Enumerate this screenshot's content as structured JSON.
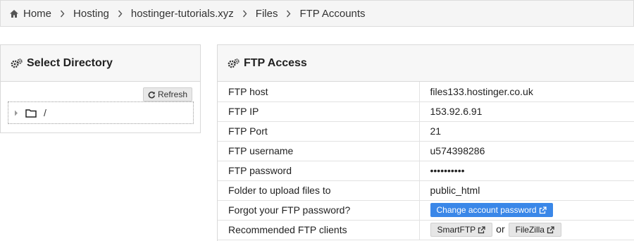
{
  "breadcrumb": {
    "items": [
      "Home",
      "Hosting",
      "hostinger-tutorials.xyz",
      "Files",
      "FTP Accounts"
    ]
  },
  "select_directory": {
    "title": "Select Directory",
    "refresh_label": "Refresh",
    "tree_root": "/"
  },
  "ftp_access": {
    "title": "FTP Access",
    "rows": [
      {
        "label": "FTP host",
        "value": "files133.hostinger.co.uk"
      },
      {
        "label": "FTP IP",
        "value": "153.92.6.91"
      },
      {
        "label": "FTP Port",
        "value": "21"
      },
      {
        "label": "FTP username",
        "value": "u574398286"
      },
      {
        "label": "FTP password",
        "value": "••••••••••"
      },
      {
        "label": "Folder to upload files to",
        "value": "public_html"
      },
      {
        "label": "Forgot your FTP password?"
      },
      {
        "label": "Recommended FTP clients"
      }
    ],
    "change_password_label": "Change account password",
    "client_1": "SmartFTP",
    "or_text": "or",
    "client_2": "FileZilla"
  },
  "colors": {
    "primary_button": "#3a87e8",
    "breadcrumb_bg": "#f5f5f5"
  },
  "icons": [
    "home-icon",
    "chevron-right-icon",
    "cogs-icon",
    "refresh-icon",
    "caret-right-icon",
    "folder-icon",
    "external-link-icon"
  ]
}
